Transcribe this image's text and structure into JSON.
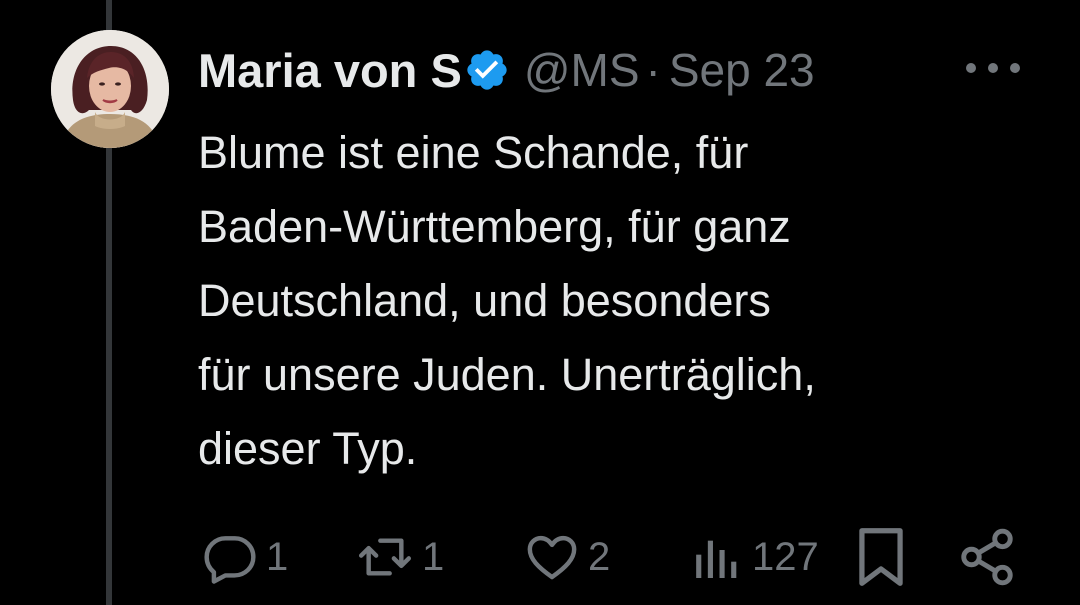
{
  "tweet": {
    "author_name": "Maria von S",
    "handle": "@MS",
    "separator": "·",
    "timestamp": "Sep 23",
    "text_lines": [
      "Blume ist eine Schande, für",
      "Baden-Württemberg, für ganz",
      "Deutschland, und besonders",
      "für unsere Juden. Unerträglich,",
      "dieser Typ."
    ]
  },
  "actions": {
    "reply_count": "1",
    "repost_count": "1",
    "like_count": "2",
    "views_count": "127"
  },
  "icons": {
    "verified": "verified-badge-icon",
    "more": "more-options-icon",
    "reply": "reply-icon",
    "repost": "repost-icon",
    "like": "heart-icon",
    "views": "views-chart-icon",
    "bookmark": "bookmark-icon",
    "share": "share-icon"
  },
  "colors": {
    "background": "#000000",
    "text_primary": "#e7e9ea",
    "text_secondary": "#71767b",
    "verified_blue": "#1d9bf0",
    "thread_line": "#333639"
  }
}
